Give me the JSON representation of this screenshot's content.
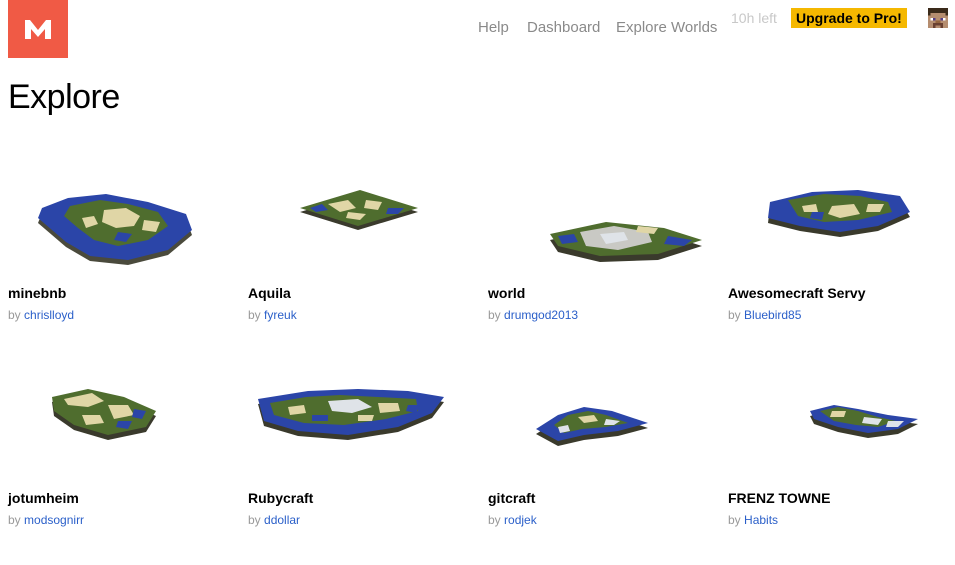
{
  "header": {
    "logo_letter": "M",
    "logo_color": "#f05a45",
    "nav": [
      "Help",
      "Dashboard",
      "Explore Worlds"
    ],
    "time_left": "10h left",
    "upgrade_label": "Upgrade to Pro!",
    "upgrade_color": "#f5b800",
    "avatar_icon": "steve-head-icon"
  },
  "page": {
    "title": "Explore"
  },
  "by_label": "by",
  "worlds": [
    {
      "name": "minebnb",
      "author": "chrislloyd"
    },
    {
      "name": "Aquila",
      "author": "fyreuk"
    },
    {
      "name": "world",
      "author": "drumgod2013"
    },
    {
      "name": "Awesomecraft Servy",
      "author": "Bluebird85"
    },
    {
      "name": "jotumheim",
      "author": "modsognirr"
    },
    {
      "name": "Rubycraft",
      "author": "ddollar"
    },
    {
      "name": "gitcraft",
      "author": "rodjek"
    },
    {
      "name": "FRENZ TOWNE",
      "author": "Habits"
    }
  ],
  "colors": {
    "link": "#2a5fc9",
    "nav": "#8a8a8a",
    "water": "#2b45a8",
    "grass": "#4f6d2e",
    "sand": "#e0d6a6",
    "snow": "#dfe3e8",
    "edge": "#4a4a3c"
  }
}
